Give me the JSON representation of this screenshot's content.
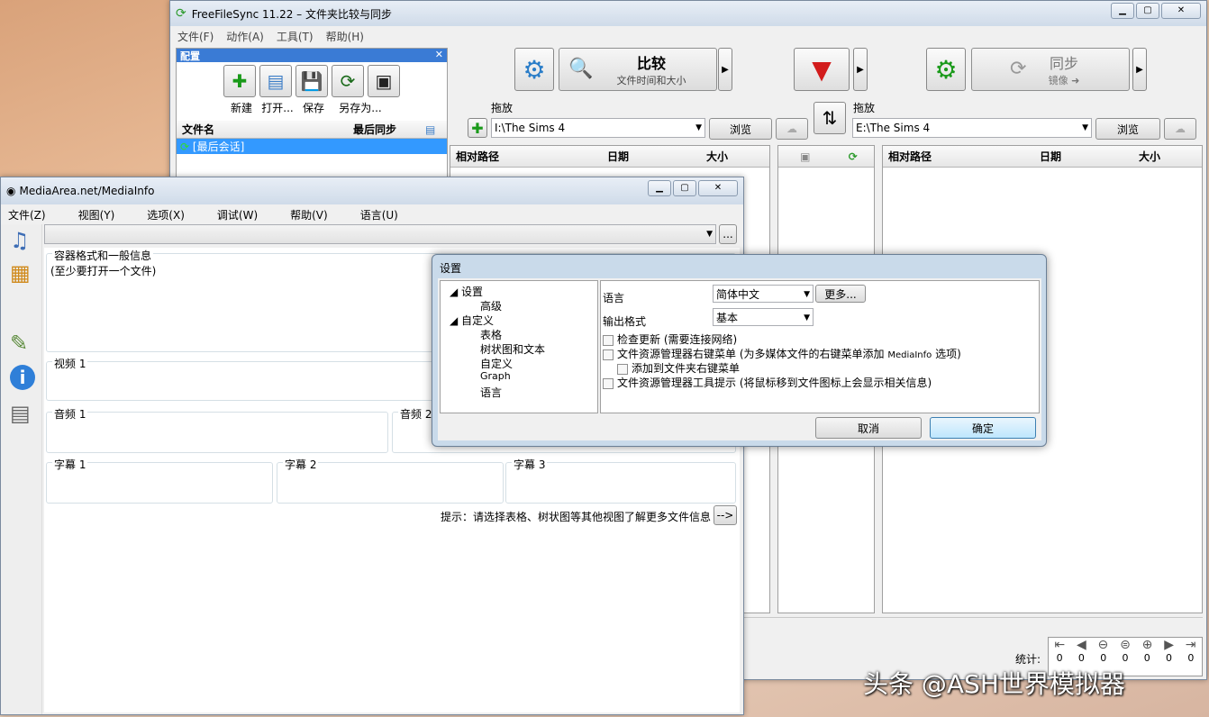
{
  "ffs": {
    "title": "FreeFileSync 11.22 – 文件夹比较与同步",
    "menu": [
      "文件(F)",
      "动作(A)",
      "工具(T)",
      "帮助(H)"
    ],
    "config_header": "配置",
    "config_buttons": [
      "新建",
      "打开...",
      "保存",
      "另存为..."
    ],
    "cfg_col_name": "文件名",
    "cfg_col_last": "最后同步",
    "last_session": "[最后会话]",
    "compare_label": "比较",
    "compare_sub": "文件时间和大小",
    "sync_label": "同步",
    "sync_sub": "镜像 ➜",
    "drop_label_left": "拖放",
    "drop_label_right": "拖放",
    "left_path": "I:\\The Sims 4",
    "right_path": "E:\\The Sims 4",
    "browse": "浏览",
    "col_rel_path": "相对路径",
    "col_date": "日期",
    "col_size": "大小",
    "stats_label": "统计:",
    "stats_values": [
      "0",
      "0",
      "0",
      "0",
      "0",
      "0",
      "0"
    ]
  },
  "mi": {
    "title": "MediaArea.net/MediaInfo",
    "menu": [
      "文件(Z)",
      "视图(Y)",
      "选项(X)",
      "调试(W)",
      "帮助(V)",
      "语言(U)"
    ],
    "container_label": "容器格式和一般信息",
    "container_hint": "(至少要打开一个文件)",
    "video1": "视频 1",
    "audio1": "音频 1",
    "audio2": "音频 2",
    "sub1": "字幕 1",
    "sub2": "字幕 2",
    "sub3": "字幕 3",
    "hint": "提示：请选择表格、树状图等其他视图了解更多文件信息",
    "hint_btn": "-->",
    "browse_btn": "..."
  },
  "settings": {
    "title": "设置",
    "tree": [
      "设置",
      "高级",
      "自定义",
      "表格",
      "树状图和文本",
      "自定义",
      "Graph",
      "语言"
    ],
    "language_label": "语言",
    "language_value": "简体中文",
    "more_btn": "更多...",
    "output_label": "输出格式",
    "output_value": "基本",
    "check1": "检查更新 (需要连接网络)",
    "check2_a": "文件资源管理器右键菜单 (为多媒体文件的右键菜单添加 ",
    "check2_b": "MediaInfo",
    "check2_c": " 选项)",
    "check3": "添加到文件夹右键菜单",
    "check4": "文件资源管理器工具提示 (将鼠标移到文件图标上会显示相关信息)",
    "cancel": "取消",
    "ok": "确定"
  },
  "watermark": "头条 @ASH世界模拟器"
}
